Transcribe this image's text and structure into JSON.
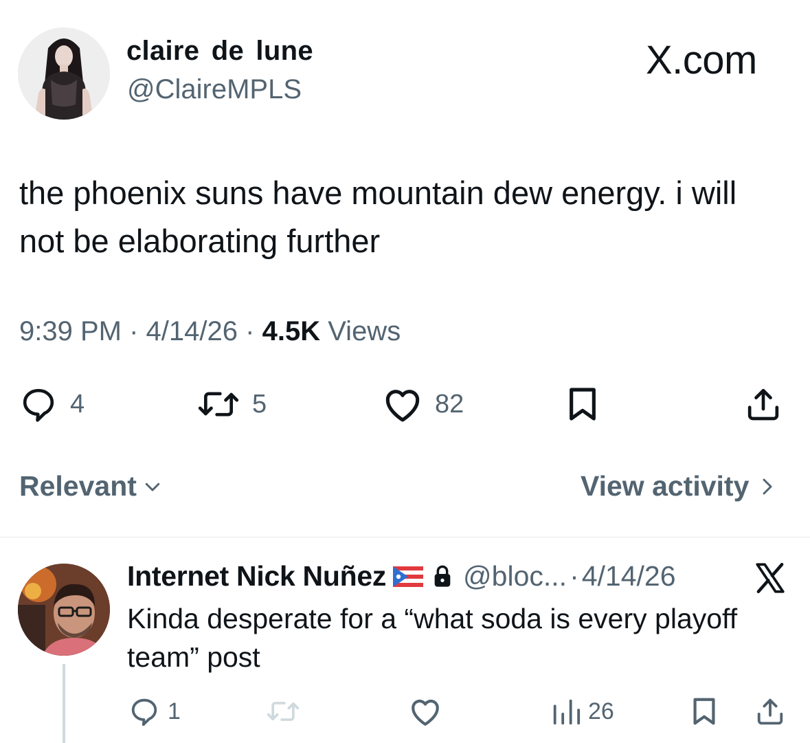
{
  "main_tweet": {
    "display_name": "claire de lune",
    "handle": "@ClaireMPLS",
    "brand": "X.com",
    "text": "the phoenix suns have mountain dew energy. i will not be elaborating further",
    "time": "9:39 PM",
    "date": "4/14/26",
    "views_count": "4.5K",
    "views_label": "Views",
    "separator": "·",
    "replies": "4",
    "reposts": "5",
    "likes": "82"
  },
  "sort_bar": {
    "relevant_label": "Relevant",
    "view_activity_label": "View activity"
  },
  "reply": {
    "display_name": "Internet Nick Nuñez",
    "handle": "@bloc...",
    "separator": "·",
    "date": "4/14/26",
    "text": "Kinda desperate for a “what soda is every playoff team” post",
    "replies": "1",
    "views": "26"
  },
  "icons": {
    "reply": "reply-bubble-icon",
    "repost": "repost-arrows-icon",
    "like": "heart-icon",
    "bookmark": "bookmark-icon",
    "share": "share-upload-icon",
    "views": "bar-chart-views-icon",
    "flag": "puerto-rico-flag-icon",
    "lock": "lock-icon",
    "x_logo": "x-logo-icon"
  },
  "colors": {
    "text_primary": "#0f1419",
    "text_secondary": "#536471",
    "divider": "#e6e9ec",
    "thread_line": "#cfd9de"
  }
}
